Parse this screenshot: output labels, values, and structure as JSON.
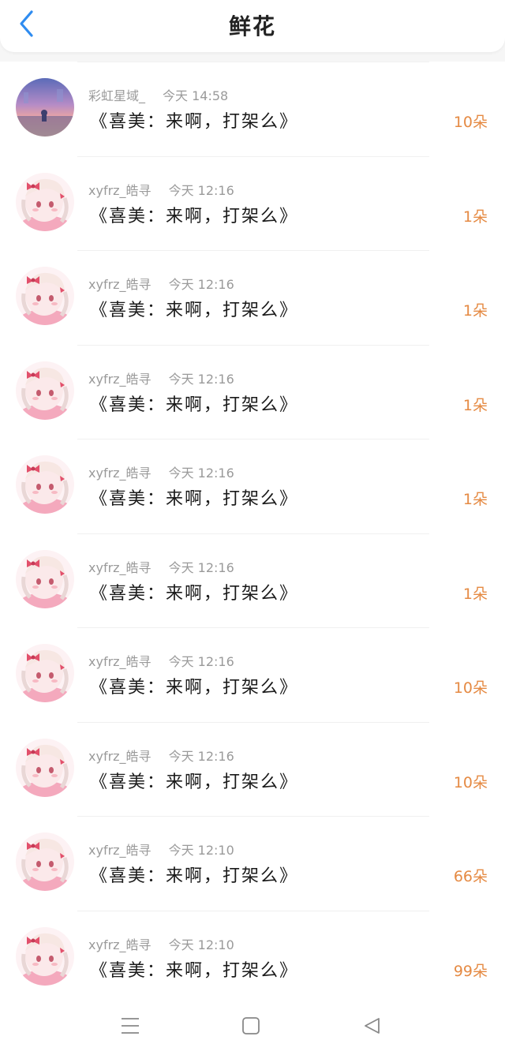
{
  "header": {
    "title": "鲜花",
    "back_icon": "chevron-left-icon",
    "back_color": "#2f8cf0"
  },
  "colors": {
    "count": "#e58a43",
    "meta": "#9a9a9a",
    "song": "#1a1a1a"
  },
  "records": [
    {
      "user": "彩虹星域_",
      "time": "今天 14:58",
      "song": "《喜美：来啊，打架么》",
      "count": "10朵",
      "avatar": "sunset-avatar"
    },
    {
      "user": "xyfrz_皓寻",
      "time": "今天 12:16",
      "song": "《喜美：来啊，打架么》",
      "count": "1朵",
      "avatar": "anime-girl-avatar"
    },
    {
      "user": "xyfrz_皓寻",
      "time": "今天 12:16",
      "song": "《喜美：来啊，打架么》",
      "count": "1朵",
      "avatar": "anime-girl-avatar"
    },
    {
      "user": "xyfrz_皓寻",
      "time": "今天 12:16",
      "song": "《喜美：来啊，打架么》",
      "count": "1朵",
      "avatar": "anime-girl-avatar"
    },
    {
      "user": "xyfrz_皓寻",
      "time": "今天 12:16",
      "song": "《喜美：来啊，打架么》",
      "count": "1朵",
      "avatar": "anime-girl-avatar"
    },
    {
      "user": "xyfrz_皓寻",
      "time": "今天 12:16",
      "song": "《喜美：来啊，打架么》",
      "count": "1朵",
      "avatar": "anime-girl-avatar"
    },
    {
      "user": "xyfrz_皓寻",
      "time": "今天 12:16",
      "song": "《喜美：来啊，打架么》",
      "count": "10朵",
      "avatar": "anime-girl-avatar"
    },
    {
      "user": "xyfrz_皓寻",
      "time": "今天 12:16",
      "song": "《喜美：来啊，打架么》",
      "count": "10朵",
      "avatar": "anime-girl-avatar"
    },
    {
      "user": "xyfrz_皓寻",
      "time": "今天 12:10",
      "song": "《喜美：来啊，打架么》",
      "count": "66朵",
      "avatar": "anime-girl-avatar"
    },
    {
      "user": "xyfrz_皓寻",
      "time": "今天 12:10",
      "song": "《喜美：来啊，打架么》",
      "count": "99朵",
      "avatar": "anime-girl-avatar"
    }
  ],
  "navbar": {
    "menu_icon": "menu-icon",
    "home_icon": "square-home-icon",
    "back_icon": "triangle-back-icon"
  }
}
